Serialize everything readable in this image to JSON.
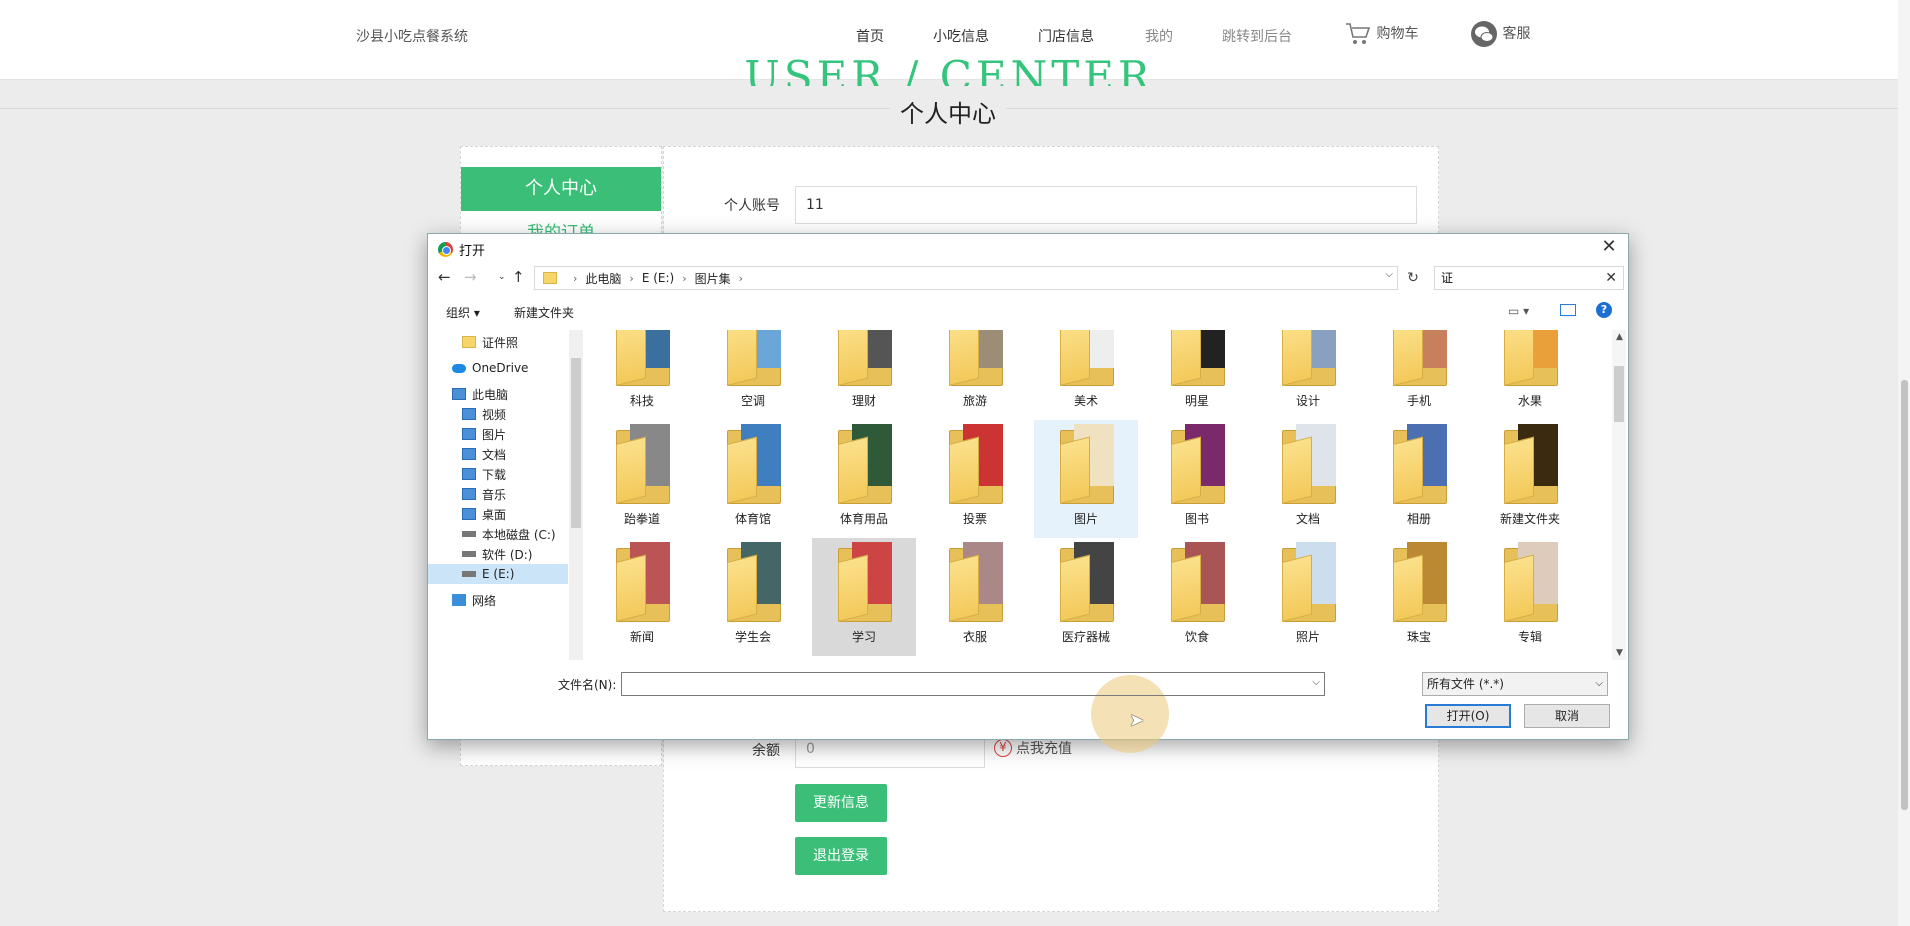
{
  "site": {
    "brand": "沙县小吃点餐系统",
    "nav": [
      "首页",
      "小吃信息",
      "门店信息",
      "我的",
      "跳转到后台"
    ],
    "cart_label": "购物车",
    "service_label": "客服"
  },
  "page": {
    "watermark": "USER / CENTER",
    "title": "个人中心",
    "sidebar": {
      "active": "个人中心",
      "second": "我的订单"
    },
    "form": {
      "account_label": "个人账号",
      "account_value": "11",
      "balance_label": "余额",
      "balance_value": "0",
      "recharge": "点我充值",
      "yen": "¥",
      "update_button": "更新信息",
      "logout_button": "退出登录"
    }
  },
  "dialog": {
    "title": "打开",
    "path": [
      "此电脑",
      "E (E:)",
      "图片集"
    ],
    "search_value": "证",
    "toolbar": {
      "organize": "组织 ▾",
      "new_folder": "新建文件夹",
      "help": "?"
    },
    "tree": [
      "证件照",
      "OneDrive",
      "此电脑",
      "视频",
      "图片",
      "文档",
      "下载",
      "音乐",
      "桌面",
      "本地磁盘 (C:)",
      "软件 (D:)",
      "E (E:)",
      "网络"
    ],
    "tree_selected": "E (E:)",
    "folders_row1": [
      "科技",
      "空调",
      "理财",
      "旅游",
      "美术",
      "明星",
      "设计",
      "手机",
      "水果"
    ],
    "folders_row2": [
      "跆拳道",
      "体育馆",
      "体育用品",
      "投票",
      "图片",
      "图书",
      "文档",
      "相册",
      "新建文件夹"
    ],
    "folders_row3": [
      "新闻",
      "学生会",
      "学习",
      "衣服",
      "医疗器械",
      "饮食",
      "照片",
      "珠宝",
      "专辑"
    ],
    "hover_folder": "图片",
    "selected_folder": "学习",
    "filename_label": "文件名(N):",
    "filename_value": "",
    "filetype": "所有文件 (*.*)",
    "open_button": "打开(O)",
    "cancel_button": "取消"
  },
  "colors": {
    "accent": "#3bbf78",
    "dialog_accent": "#2a7bd4"
  }
}
